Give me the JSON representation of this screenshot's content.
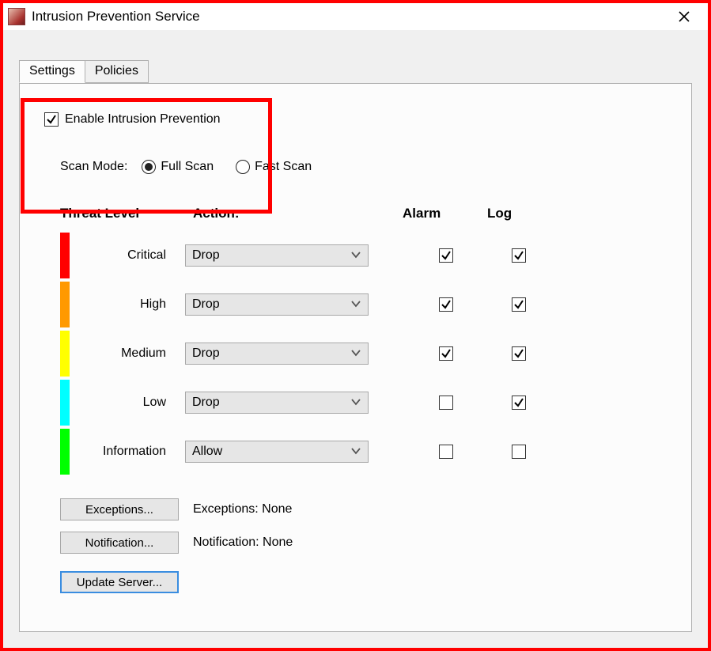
{
  "title": "Intrusion Prevention Service",
  "tabs": [
    "Settings",
    "Policies"
  ],
  "active_tab": 0,
  "enable": {
    "label": "Enable Intrusion Prevention",
    "checked": true
  },
  "scan_mode": {
    "label": "Scan Mode:",
    "options": [
      "Full Scan",
      "Fast Scan"
    ],
    "selected": 0
  },
  "headers": {
    "threat": "Threat Level",
    "action": "Action:",
    "alarm": "Alarm",
    "log": "Log"
  },
  "levels": [
    {
      "name": "Critical",
      "color": "#ff0000",
      "action": "Drop",
      "alarm": true,
      "log": true
    },
    {
      "name": "High",
      "color": "#ff9900",
      "action": "Drop",
      "alarm": true,
      "log": true
    },
    {
      "name": "Medium",
      "color": "#ffff00",
      "action": "Drop",
      "alarm": true,
      "log": true
    },
    {
      "name": "Low",
      "color": "#00ffff",
      "action": "Drop",
      "alarm": false,
      "log": true
    },
    {
      "name": "Information",
      "color": "#00ff00",
      "action": "Allow",
      "alarm": false,
      "log": false
    }
  ],
  "buttons": {
    "exceptions": "Exceptions...",
    "notification": "Notification...",
    "update_server": "Update Server..."
  },
  "status": {
    "exceptions": "Exceptions: None",
    "notification": "Notification: None"
  }
}
